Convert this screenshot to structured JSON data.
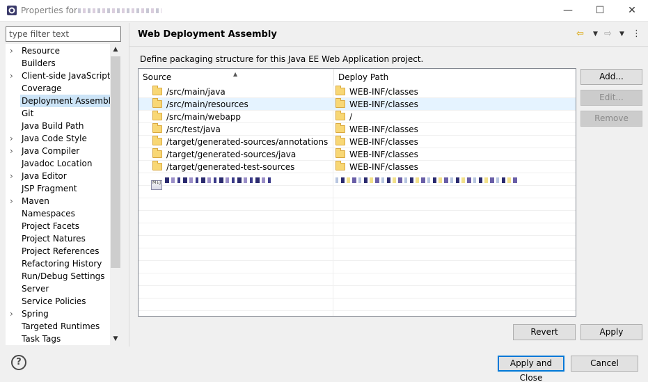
{
  "window": {
    "title": "Properties for",
    "minimize_glyph": "—",
    "maximize_glyph": "☐",
    "close_glyph": "✕"
  },
  "sidebar": {
    "filter_placeholder": "type filter text",
    "items": [
      {
        "label": "Resource",
        "expandable": true
      },
      {
        "label": "Builders",
        "expandable": false
      },
      {
        "label": "Client-side JavaScript",
        "expandable": true
      },
      {
        "label": "Coverage",
        "expandable": false
      },
      {
        "label": "Deployment Assembly",
        "expandable": false,
        "selected": true
      },
      {
        "label": "Git",
        "expandable": false
      },
      {
        "label": "Java Build Path",
        "expandable": false
      },
      {
        "label": "Java Code Style",
        "expandable": true
      },
      {
        "label": "Java Compiler",
        "expandable": true
      },
      {
        "label": "Javadoc Location",
        "expandable": false
      },
      {
        "label": "Java Editor",
        "expandable": true
      },
      {
        "label": "JSP Fragment",
        "expandable": false
      },
      {
        "label": "Maven",
        "expandable": true
      },
      {
        "label": "Namespaces",
        "expandable": false
      },
      {
        "label": "Project Facets",
        "expandable": false
      },
      {
        "label": "Project Natures",
        "expandable": false
      },
      {
        "label": "Project References",
        "expandable": false
      },
      {
        "label": "Refactoring History",
        "expandable": false
      },
      {
        "label": "Run/Debug Settings",
        "expandable": false
      },
      {
        "label": "Server",
        "expandable": false
      },
      {
        "label": "Service Policies",
        "expandable": false
      },
      {
        "label": "Spring",
        "expandable": true
      },
      {
        "label": "Targeted Runtimes",
        "expandable": false
      },
      {
        "label": "Task Tags",
        "expandable": false
      }
    ]
  },
  "main": {
    "title": "Web Deployment Assembly",
    "description": "Define packaging structure for this Java EE Web Application project.",
    "table": {
      "columns": [
        "Source",
        "Deploy Path"
      ],
      "rows": [
        {
          "source": "/src/main/java",
          "deploy": "WEB-INF/classes"
        },
        {
          "source": "/src/main/resources",
          "deploy": "WEB-INF/classes",
          "selected": true
        },
        {
          "source": "/src/main/webapp",
          "deploy": "/"
        },
        {
          "source": "/src/test/java",
          "deploy": "WEB-INF/classes"
        },
        {
          "source": "/target/generated-sources/annotations",
          "deploy": "WEB-INF/classes"
        },
        {
          "source": "/target/generated-sources/java",
          "deploy": "WEB-INF/classes"
        },
        {
          "source": "/target/generated-test-sources",
          "deploy": "WEB-INF/classes"
        }
      ]
    },
    "buttons": {
      "add": "Add...",
      "edit": "Edit...",
      "remove": "Remove",
      "revert": "Revert",
      "apply": "Apply"
    }
  },
  "footer": {
    "apply_close": "Apply and Close",
    "cancel": "Cancel",
    "help_glyph": "?"
  },
  "colors": {
    "selection": "#cce4f7",
    "row_selection": "#e5f3ff",
    "default_button_border": "#0078d7"
  }
}
